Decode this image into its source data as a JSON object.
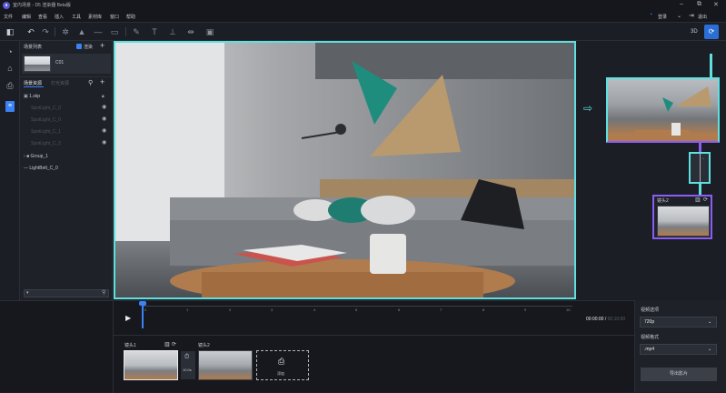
{
  "app": {
    "title": "室内场景 - D5 渲染器 Beta版"
  },
  "window_controls": {
    "minimize": "–",
    "restore": "⧉",
    "close": "✕"
  },
  "menu": {
    "items": [
      "文件",
      "编辑",
      "查看",
      "插入",
      "工具",
      "素材库",
      "窗口",
      "帮助"
    ]
  },
  "header_right": {
    "account": "登录",
    "exit": "退出"
  },
  "toolbar": {
    "view_3d": "3D"
  },
  "scene_list": {
    "title": "场景列表",
    "filter_label": "渲染",
    "add": "+",
    "item": "C01"
  },
  "assets": {
    "tab_active": "场景资源",
    "tab_inactive": "灯光资源",
    "rows": [
      {
        "label": "1.skp",
        "dim": false
      },
      {
        "label": "SpotLight_C_0",
        "dim": true
      },
      {
        "label": "SpotLight_C_0",
        "dim": true
      },
      {
        "label": "SpotLight_C_1",
        "dim": true
      },
      {
        "label": "SpotLight_C_2",
        "dim": true
      },
      {
        "label": "Group_1",
        "dim": false
      },
      {
        "label": "LightBelt_C_0",
        "dim": false
      }
    ]
  },
  "camera": {
    "label": "镜头2"
  },
  "timeline": {
    "ticks": [
      "0",
      "1",
      "2",
      "3",
      "4",
      "5",
      "6",
      "7",
      "8",
      "9",
      "10"
    ],
    "current": "00:00:00",
    "separator": "/",
    "total": "00:10:00"
  },
  "clips": {
    "clip1_label": "镜头1",
    "clip2_label": "镜头2",
    "transition_label": "10.0s",
    "add_label": "添加"
  },
  "export": {
    "quality_label": "视频选项",
    "quality_value": "720p",
    "format_label": "视频格式",
    "format_value": ".mp4",
    "button": "导出影片"
  },
  "colors": {
    "accent": "#5fe0e0",
    "purple": "#8b5cf6",
    "blue": "#2b6fd6"
  }
}
